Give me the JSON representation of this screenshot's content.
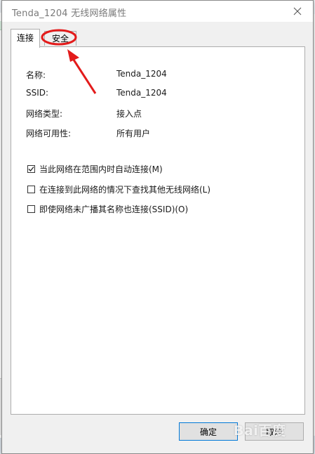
{
  "dialog": {
    "title": "Tenda_1204 无线网络属性"
  },
  "tabs": [
    {
      "label": "连接",
      "active": true
    },
    {
      "label": "安全",
      "active": false
    }
  ],
  "fields": [
    {
      "label": "名称:",
      "value": "Tenda_1204"
    },
    {
      "label": "SSID:",
      "value": "Tenda_1204"
    },
    {
      "label": "网络类型:",
      "value": "接入点"
    },
    {
      "label": "网络可用性:",
      "value": "所有用户"
    }
  ],
  "options": [
    {
      "label": "当此网络在范围内时自动连接(M)",
      "checked": true
    },
    {
      "label": "在连接到此网络的情况下查找其他无线网络(L)",
      "checked": false
    },
    {
      "label": "即使网络未广播其名称也连接(SSID)(O)",
      "checked": false
    }
  ],
  "buttons": {
    "ok": "确定",
    "cancel": "取消"
  },
  "annotation": {
    "color": "#e31b1b"
  },
  "watermark": {
    "text": "Bai百度"
  }
}
